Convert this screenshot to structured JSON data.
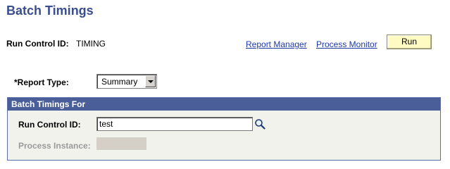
{
  "page": {
    "title": "Batch Timings"
  },
  "run_control": {
    "label": "Run Control ID:",
    "value": "TIMING"
  },
  "links": {
    "report_manager": "Report Manager",
    "process_monitor": "Process Monitor"
  },
  "run_button": {
    "label": "Run"
  },
  "report_type": {
    "label": "*Report Type:",
    "selected": "Summary"
  },
  "group": {
    "header": "Batch Timings For",
    "run_control_label": "Run Control ID:",
    "run_control_value": "test",
    "process_instance_label": "Process Instance:",
    "process_instance_value": ""
  },
  "icons": {
    "lookup": "magnifier-lookup-icon",
    "dropdown": "chevron-down-icon"
  },
  "colors": {
    "title": "#3a4e8c",
    "header_bg": "#4a5f9a",
    "link": "#1f3aa5",
    "run_button_bg": "#fffbc3",
    "group_bg": "#f2f2ec"
  }
}
